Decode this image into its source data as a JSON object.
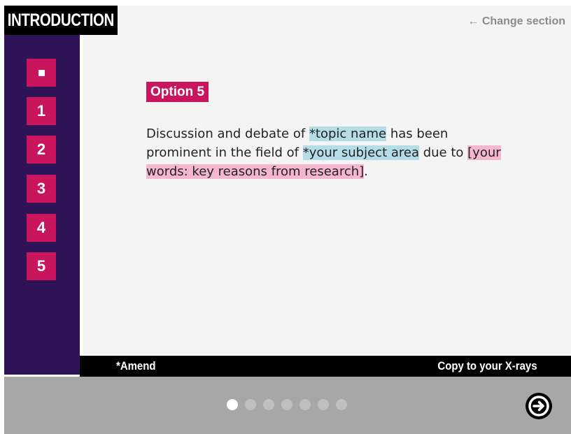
{
  "header": {
    "title": "INTRODUCTION",
    "change_section": "← Change section"
  },
  "sidebar": {
    "items": [
      {
        "label": "",
        "icon": "square-icon"
      },
      {
        "label": "1"
      },
      {
        "label": "2"
      },
      {
        "label": "3"
      },
      {
        "label": "4"
      },
      {
        "label": "5"
      }
    ]
  },
  "main": {
    "option_label": "Option 5",
    "paragraph": {
      "part1": "Discussion and debate of ",
      "topic": "*topic name",
      "part2": " has been prominent in the field of ",
      "subject": "*your subject area",
      "part3": " due to ",
      "reasons": "[your words: key reasons from research]",
      "part4": "."
    }
  },
  "bottom_bar": {
    "amend": "*Amend",
    "copy": "Copy to your X-rays"
  },
  "footer": {
    "dots_total": 7,
    "active_dot": 1,
    "next_icon": "arrow-right-circle-icon"
  },
  "colors": {
    "accent": "#c8155d",
    "sidebar": "#2e1457",
    "highlight_blue": "#b4dde8",
    "highlight_pink": "#f5b6d0"
  }
}
